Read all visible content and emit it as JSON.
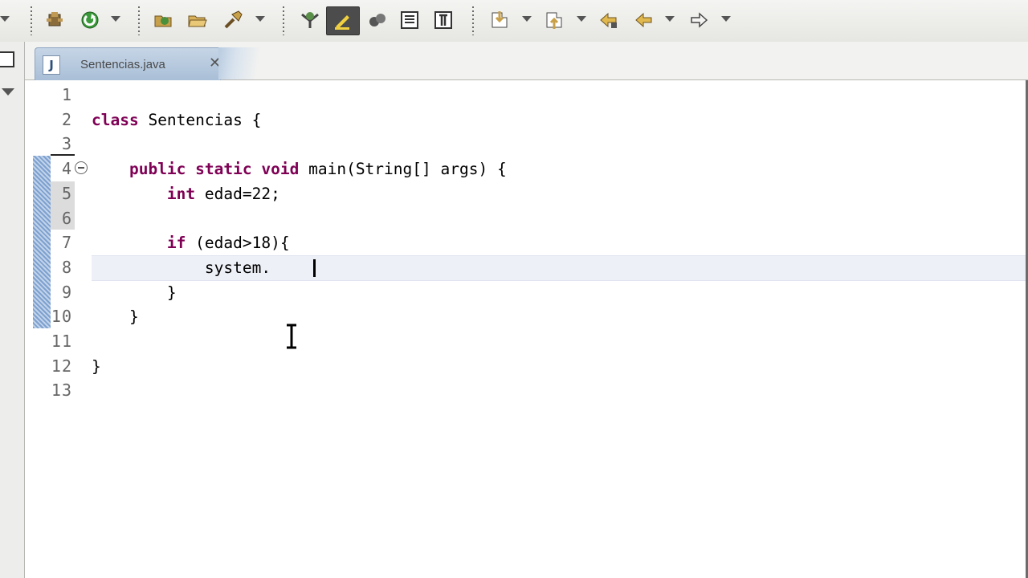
{
  "editor": {
    "tab": {
      "filename": "Sentencias.java",
      "close_glyph": "✕",
      "file_icon": "J"
    },
    "lines": [
      {
        "num": "1",
        "code": ""
      },
      {
        "num": "2",
        "code": "class Sentencias {"
      },
      {
        "num": "3",
        "code": ""
      },
      {
        "num": "4",
        "code": "    public static void main(String[] args) {"
      },
      {
        "num": "5",
        "code": "        int edad=22;"
      },
      {
        "num": "6",
        "code": ""
      },
      {
        "num": "7",
        "code": "        if (edad>18){"
      },
      {
        "num": "8",
        "code": "            system."
      },
      {
        "num": "9",
        "code": "        }"
      },
      {
        "num": "10",
        "code": "    }"
      },
      {
        "num": "11",
        "code": ""
      },
      {
        "num": "12",
        "code": "}"
      },
      {
        "num": "13",
        "code": ""
      }
    ],
    "current_line": "8"
  },
  "toolbar": {
    "icons": [
      "new-class-icon",
      "run-icon",
      "open-type-icon",
      "open-folder-icon",
      "search-icon",
      "task-icon",
      "highlight-icon",
      "plugin-icon",
      "show-whitespace-icon",
      "block-selection-icon",
      "next-annotation-icon",
      "prev-annotation-icon",
      "last-edit-icon",
      "back-icon",
      "forward-icon"
    ]
  }
}
